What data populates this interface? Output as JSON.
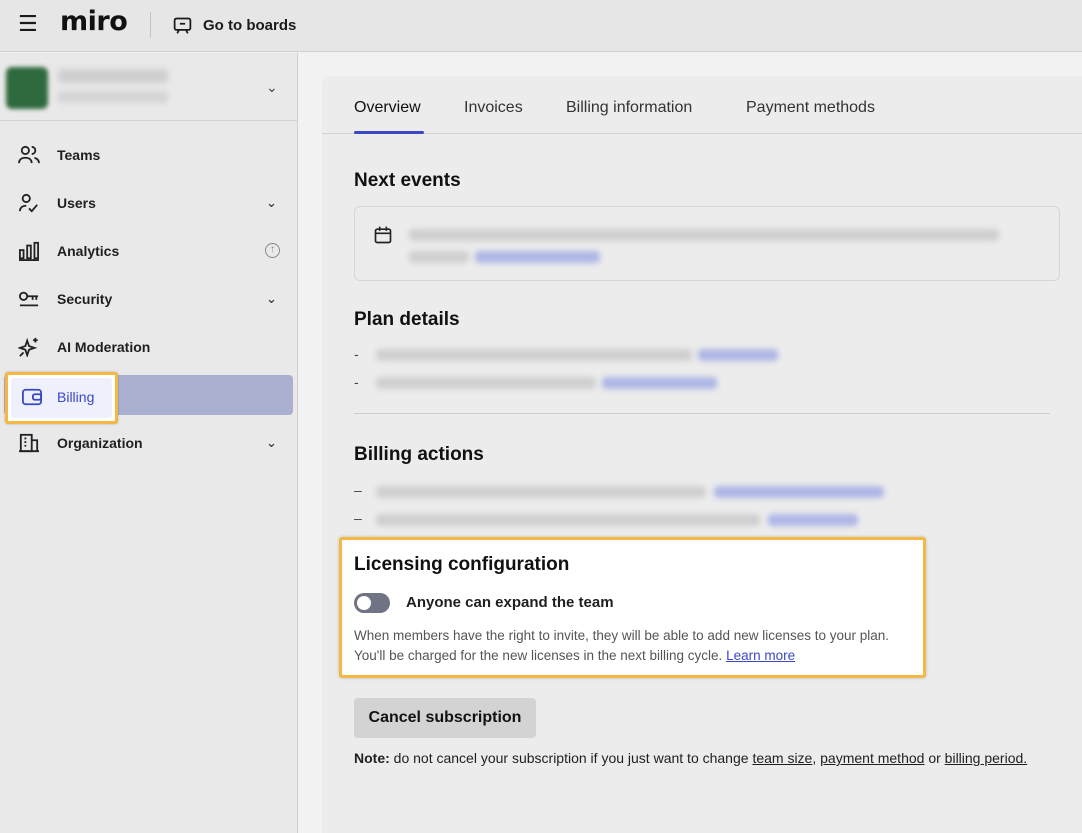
{
  "app": {
    "logo": "miro",
    "go_to_boards": "Go to boards"
  },
  "sidebar": {
    "items": [
      {
        "label": "Teams",
        "icon": "users-icon",
        "caret": false
      },
      {
        "label": "Users",
        "icon": "user-check-icon",
        "caret": true
      },
      {
        "label": "Analytics",
        "icon": "bar-chart-icon",
        "caret": false,
        "badge": "upgrade-icon"
      },
      {
        "label": "Security",
        "icon": "key-icon",
        "caret": true
      },
      {
        "label": "AI Moderation",
        "icon": "sparkles-icon",
        "caret": false
      },
      {
        "label": "Billing",
        "icon": "wallet-icon",
        "caret": false,
        "active": true
      },
      {
        "label": "Organization",
        "icon": "building-icon",
        "caret": true
      }
    ]
  },
  "tabs": [
    {
      "label": "Overview",
      "active": true
    },
    {
      "label": "Invoices"
    },
    {
      "label": "Billing information"
    },
    {
      "label": "Payment methods"
    }
  ],
  "sections": {
    "next_events": "Next events",
    "plan_details": "Plan details",
    "billing_actions": "Billing actions"
  },
  "licensing": {
    "title": "Licensing configuration",
    "toggle_label": "Anyone can expand the team",
    "toggle_on": false,
    "description": "When members have the right to invite, they will be able to add new licenses to your plan. You'll be charged for the new licenses in the next billing cycle.",
    "learn_more": "Learn more"
  },
  "cancel": {
    "button": "Cancel subscription",
    "note_prefix": "Note:",
    "note_text": " do not cancel your subscription if you just want to change ",
    "link_team_size": "team size",
    "sep1": ", ",
    "link_payment_method": "payment method",
    "sep2": " or ",
    "link_billing_period": "billing period."
  },
  "colors": {
    "accent": "#3b47c7",
    "highlight": "#f5b843",
    "active_nav": "#aab0d0"
  }
}
